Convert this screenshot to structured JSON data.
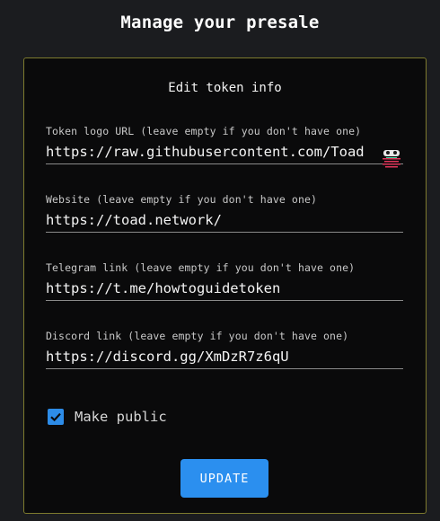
{
  "page": {
    "title": "Manage your presale"
  },
  "panel": {
    "title": "Edit token info",
    "fields": [
      {
        "label": "Token logo URL (leave empty if you don't have one)",
        "value": "https://raw.githubusercontent.com/Toad"
      },
      {
        "label": "Website (leave empty if you don't have one)",
        "value": "https://toad.network/"
      },
      {
        "label": "Telegram link (leave empty if you don't have one)",
        "value": "https://t.me/howtoguidetoken"
      },
      {
        "label": "Discord link (leave empty if you don't have one)",
        "value": "https://discord.gg/XmDzR7z6qU"
      }
    ],
    "make_public": {
      "label": "Make public",
      "checked": true
    },
    "update_label": "UPDATE"
  },
  "icons": {
    "logo_thumbnail": "toad-logo-icon",
    "checkbox": "checkmark-icon"
  },
  "colors": {
    "background": "#1b1c1f",
    "panel": "#0a0a0b",
    "panel_border": "#7d7a2e",
    "accent": "#2b8fef"
  }
}
